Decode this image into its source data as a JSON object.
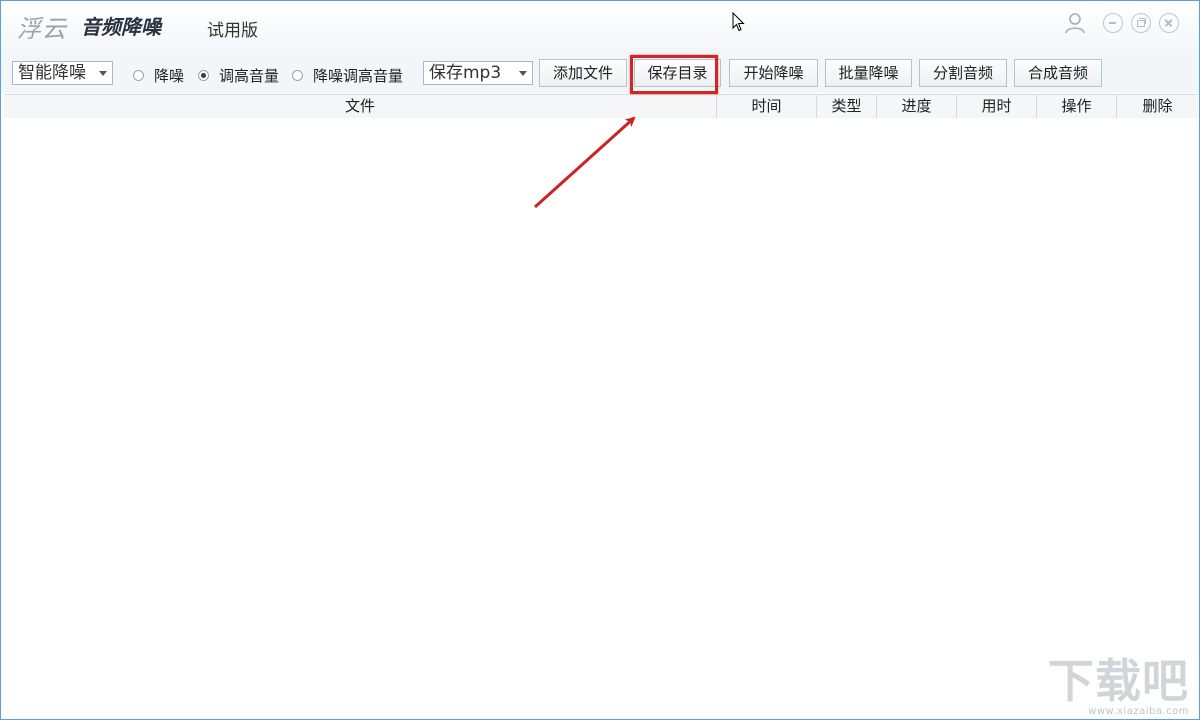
{
  "titlebar": {
    "brand": "浮云",
    "product": "音频降噪",
    "edition": "试用版"
  },
  "toolbar": {
    "mode_select": "智能降噪",
    "radios": [
      {
        "label": "降噪",
        "checked": false
      },
      {
        "label": "调高音量",
        "checked": true
      },
      {
        "label": "降噪调高音量",
        "checked": false
      }
    ],
    "format_select": "保存mp3",
    "buttons": {
      "add_file": "添加文件",
      "save_dir": "保存目录",
      "start": "开始降噪",
      "batch": "批量降噪",
      "split": "分割音频",
      "merge": "合成音频"
    }
  },
  "table": {
    "columns": [
      "文件",
      "时间",
      "类型",
      "进度",
      "用时",
      "操作",
      "删除"
    ],
    "rows": []
  },
  "watermark": {
    "logo": "下载吧",
    "url": "www.xiazaiba.com"
  },
  "annotation": {
    "highlight_color": "#d42525",
    "target": "保存目录"
  }
}
